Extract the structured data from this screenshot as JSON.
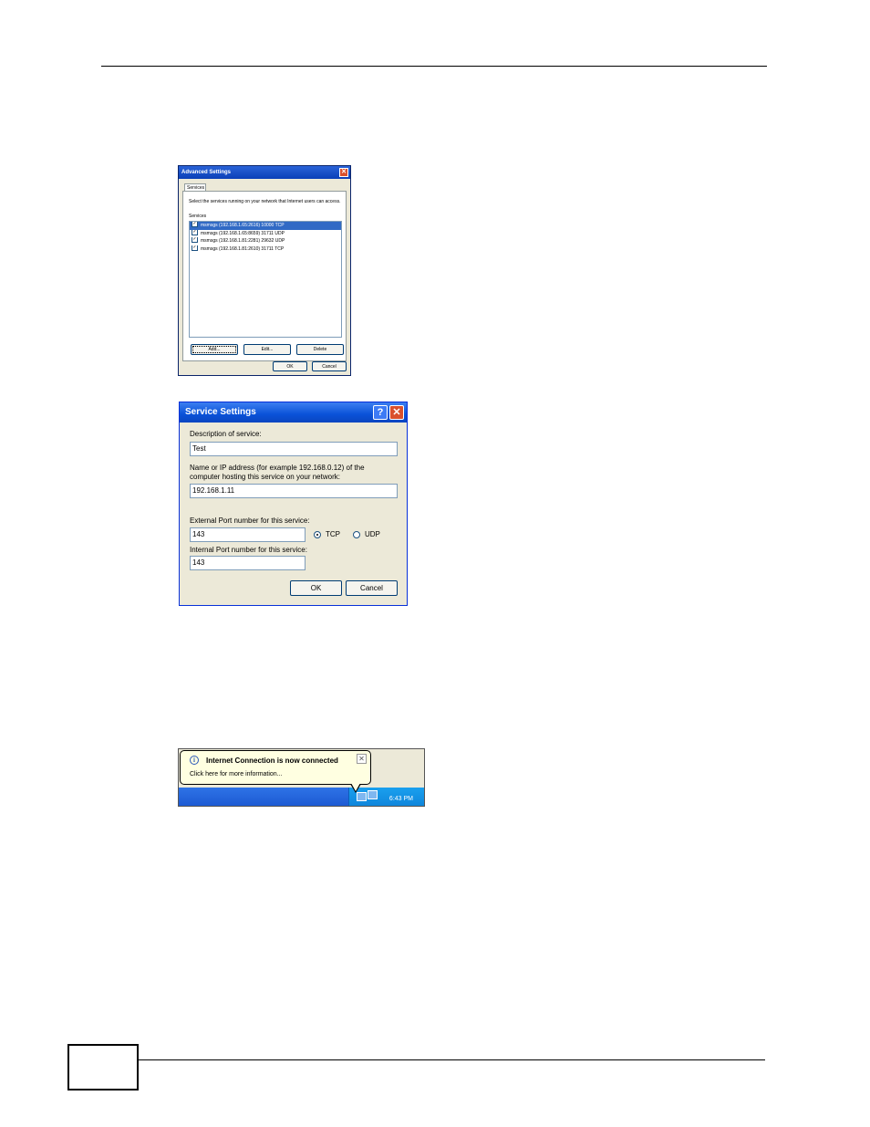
{
  "advanced_settings": {
    "title": "Advanced Settings",
    "tab": "Services",
    "description": "Select the services running on your network that Internet users can access.",
    "services_label": "Services",
    "services": [
      {
        "label": "msmsgs (192.168.1.65:2616) 10000 TCP",
        "checked": true,
        "selected": true
      },
      {
        "label": "msmsgs (192.168.1.65:8659) 31711 UDP",
        "checked": true,
        "selected": false
      },
      {
        "label": "msmsgs (192.168.1.81:2281) 29632 UDP",
        "checked": true,
        "selected": false
      },
      {
        "label": "msmsgs (192.168.1.81:2610) 31711 TCP",
        "checked": true,
        "selected": false
      }
    ],
    "add_label": "Add...",
    "edit_label": "Edit...",
    "delete_label": "Delete",
    "ok_label": "OK",
    "cancel_label": "Cancel"
  },
  "service_settings": {
    "title": "Service Settings",
    "help_glyph": "?",
    "close_glyph": "✕",
    "description_label": "Description of service:",
    "description_value": "Test",
    "host_label_line1": "Name or IP address (for example 192.168.0.12) of the",
    "host_label_line2": "computer hosting this service on your network:",
    "host_value": "192.168.1.11",
    "external_port_label": "External Port number for this service:",
    "external_port_value": "143",
    "tcp_label": "TCP",
    "udp_label": "UDP",
    "protocol_selected": "TCP",
    "internal_port_label": "Internal Port number for this service:",
    "internal_port_value": "143",
    "ok_label": "OK",
    "cancel_label": "Cancel"
  },
  "notification": {
    "title": "Internet Connection is now connected",
    "message": "Click here for more information...",
    "close_glyph": "✕",
    "clock": "6:43 PM"
  }
}
